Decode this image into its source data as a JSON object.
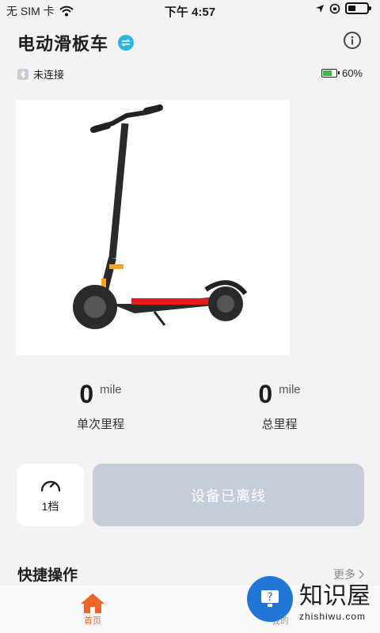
{
  "status_bar": {
    "carrier": "无 SIM 卡",
    "time": "下午 4:57"
  },
  "header": {
    "title": "电动滑板车"
  },
  "connection": {
    "status": "未连接"
  },
  "battery": {
    "percent_label": "60%",
    "level": 0.6,
    "color": "#3dbb4a"
  },
  "stats": [
    {
      "value": "0",
      "unit": "mile",
      "label": "单次里程"
    },
    {
      "value": "0",
      "unit": "mile",
      "label": "总里程"
    }
  ],
  "gear": {
    "label": "1档"
  },
  "offline_button": {
    "label": "设备已离线"
  },
  "quick": {
    "title": "快捷操作",
    "more": "更多"
  },
  "tabs": {
    "home": "首页",
    "mine": "我的"
  },
  "watermark": {
    "main": "知识屋",
    "sub": "zhishiwu.com"
  },
  "colors": {
    "accent": "#f0642a",
    "offline": "#c7ccd9",
    "swap": "#2bb7e0"
  }
}
